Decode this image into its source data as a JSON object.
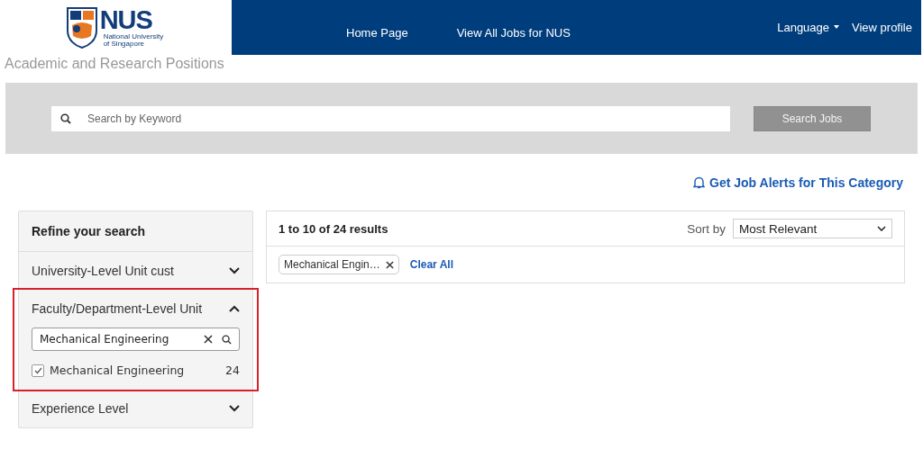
{
  "header": {
    "logo": {
      "name": "NUS",
      "subtitle_lines": [
        "National University",
        "of Singapore"
      ]
    },
    "nav": [
      {
        "label": "Home Page"
      },
      {
        "label": "View All Jobs for NUS"
      }
    ],
    "right_links": [
      {
        "label": "Language",
        "dropdown": true
      },
      {
        "label": "View profile",
        "dropdown": false
      }
    ]
  },
  "page_subtitle": "Academic and Research Positions",
  "search": {
    "placeholder": "Search by Keyword",
    "button": "Search Jobs"
  },
  "alert_link": "Get Job Alerts for This Category",
  "sidebar": {
    "title": "Refine your search",
    "facets": [
      {
        "label": "University-Level Unit cust",
        "expanded": false,
        "highlighted": false
      },
      {
        "label": "Faculty/Department-Level Unit",
        "expanded": true,
        "highlighted": true,
        "filter_value": "Mechanical Engineering",
        "options": [
          {
            "label": "Mechanical Engineering",
            "count": "24",
            "checked": true
          }
        ]
      },
      {
        "label": "Experience Level",
        "expanded": false,
        "highlighted": false
      }
    ]
  },
  "results": {
    "summary": "1 to 10 of 24 results",
    "sort_label": "Sort by",
    "sort_value": "Most Relevant",
    "chips": [
      {
        "label": "Mechanical Engin…"
      }
    ],
    "clear_all": "Clear All"
  }
}
